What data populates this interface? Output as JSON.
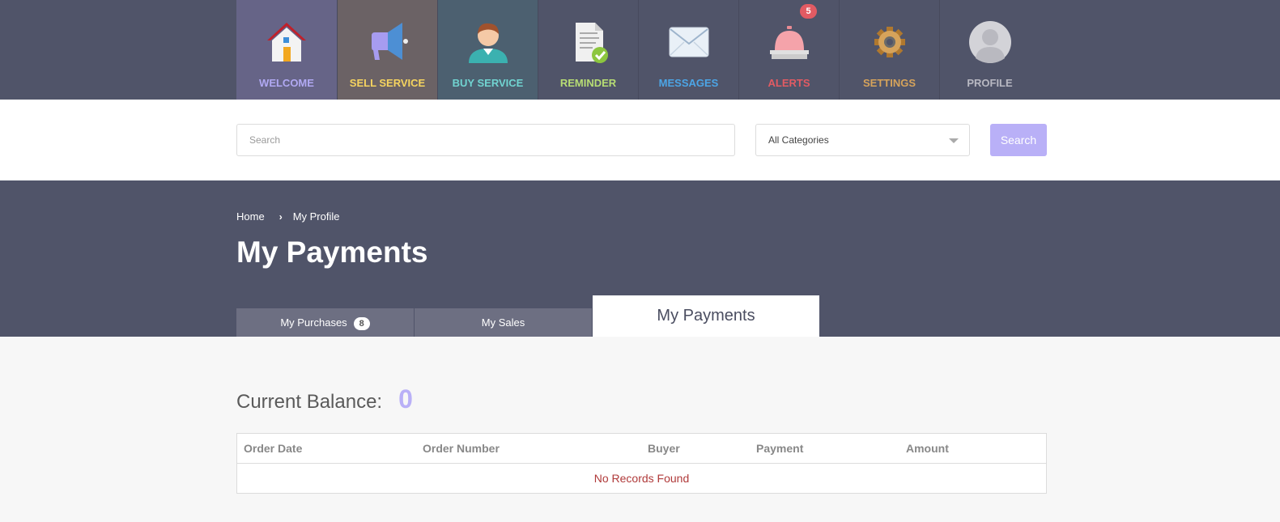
{
  "nav": {
    "items": [
      {
        "label": "WELCOME",
        "icon": "house-icon",
        "color": "#b1a9f3",
        "bg": "#666487"
      },
      {
        "label": "SELL SERVICE",
        "icon": "megaphone-icon",
        "color": "#f6d45f",
        "bg": "#6b6265"
      },
      {
        "label": "BUY SERVICE",
        "icon": "person-icon",
        "color": "#71d4d1",
        "bg": "#4c6070"
      },
      {
        "label": "REMINDER",
        "icon": "document-check-icon",
        "color": "#b7dd74"
      },
      {
        "label": "MESSAGES",
        "icon": "envelope-icon",
        "color": "#4ca5e6"
      },
      {
        "label": "ALERTS",
        "icon": "service-bell-icon",
        "color": "#e25b63",
        "badge": "5"
      },
      {
        "label": "SETTINGS",
        "icon": "gear-icon",
        "color": "#d6a35b"
      },
      {
        "label": "PROFILE",
        "icon": "avatar-icon",
        "color": "#b8b8c2"
      }
    ]
  },
  "search": {
    "placeholder": "Search",
    "category": "All Categories",
    "button": "Search"
  },
  "breadcrumb": {
    "home": "Home",
    "current": "My Profile"
  },
  "page_title": "My Payments",
  "tabs": {
    "purchases": "My Purchases",
    "purchases_count": "8",
    "sales": "My Sales",
    "payments": "My Payments"
  },
  "balance": {
    "label": "Current Balance:",
    "value": "0"
  },
  "table": {
    "columns": [
      "Order Date",
      "Order Number",
      "Buyer",
      "Payment",
      "Amount"
    ],
    "empty": "No Records Found"
  }
}
